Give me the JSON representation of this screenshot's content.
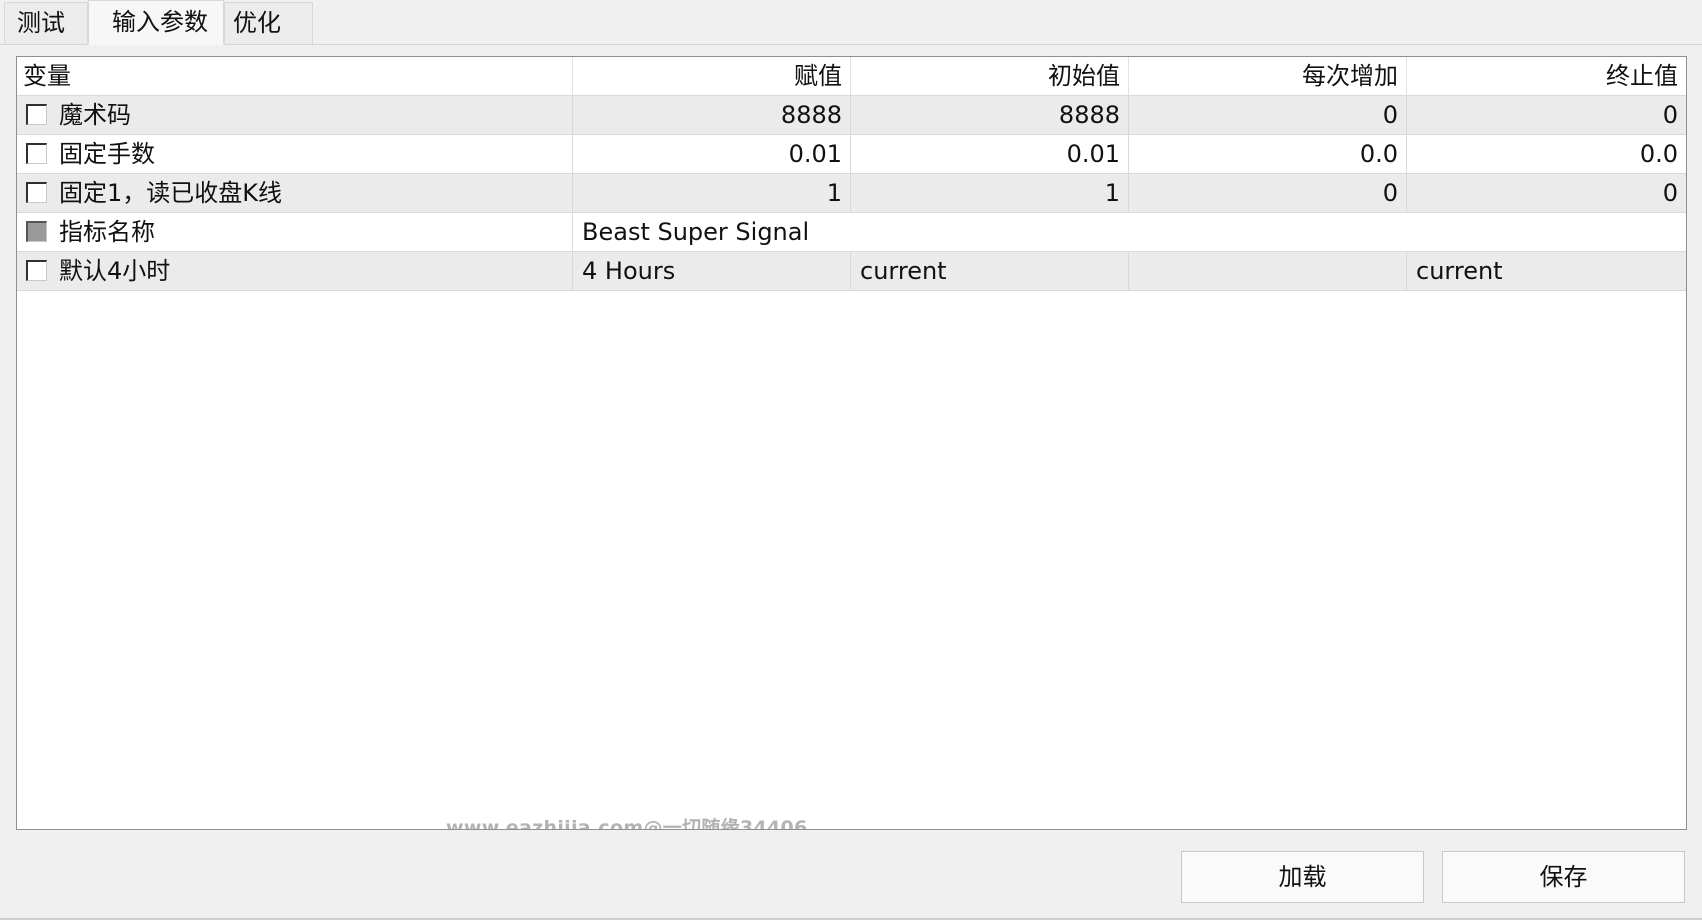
{
  "tabs": [
    {
      "label": "测试"
    },
    {
      "label": "输入参数"
    },
    {
      "label": "优化"
    }
  ],
  "active_tab": "输入参数",
  "table": {
    "columns": [
      "变量",
      "赋值",
      "初始值",
      "每次增加",
      "终止值"
    ],
    "rows": [
      {
        "name": "魔术码",
        "value": "8888",
        "start": "8888",
        "step": "0",
        "stop": "0",
        "checked": false
      },
      {
        "name": "固定手数",
        "value": "0.01",
        "start": "0.01",
        "step": "0.0",
        "stop": "0.0",
        "checked": false
      },
      {
        "name": "固定1，读已收盘K线",
        "value": "1",
        "start": "1",
        "step": "0",
        "stop": "0",
        "checked": false
      },
      {
        "name": "指标名称",
        "value": "Beast Super Signal",
        "checked": false,
        "disabled": true
      },
      {
        "name": "默认4小时",
        "value": "4 Hours",
        "start": "current",
        "step": "",
        "stop": "current",
        "checked": false
      }
    ]
  },
  "watermark": "www.eazhijia.com@一切随缘34406",
  "buttons": {
    "load": "加载",
    "save": "保存"
  }
}
